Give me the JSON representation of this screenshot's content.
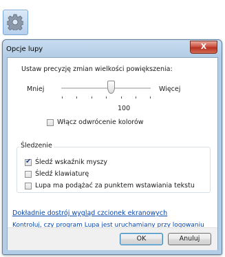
{
  "launcher": {
    "icon": "gear-icon"
  },
  "window": {
    "title": "Opcje lupy",
    "close_label": "X"
  },
  "zoom": {
    "heading": "Ustaw precyzję zmian wielkości powiększenia:",
    "less_label": "Mniej",
    "more_label": "Więcej",
    "value": "100",
    "slider_position": 0.55
  },
  "invert_colors": {
    "label": "Włącz odwrócenie kolorów",
    "checked": false
  },
  "tracking": {
    "title": "Śledzenie",
    "options": [
      {
        "label": "Śledź wskaźnik myszy",
        "checked": true
      },
      {
        "label": "Śledź klawiaturę",
        "checked": false
      },
      {
        "label": "Lupa ma podążać za punktem wstawiania tekstu",
        "checked": false
      }
    ]
  },
  "links": {
    "fine_tune": "Dokładnie dostrój wygląd czcionek ekranowych",
    "logon": "Kontroluj, czy program Lupa jest uruchamiany przy logowaniu"
  },
  "buttons": {
    "ok": "OK",
    "cancel": "Anuluj"
  }
}
